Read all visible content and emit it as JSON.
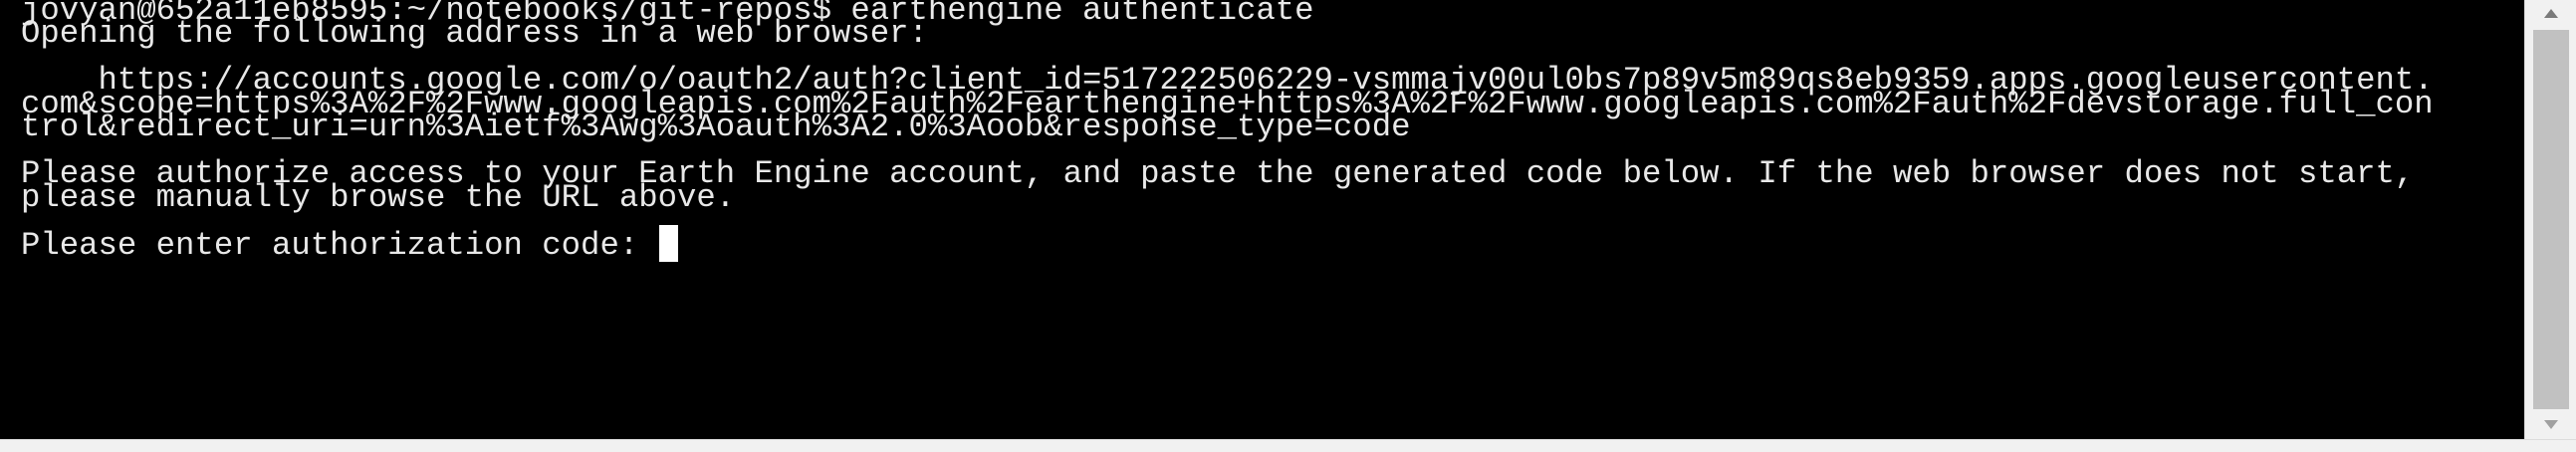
{
  "terminal": {
    "lines": [
      "jovyan@652a11eb8595:~/notebooks/git-repos$ earthengine authenticate",
      "Opening the following address in a web browser:",
      "",
      "    https://accounts.google.com/o/oauth2/auth?client_id=517222506229-vsmmajv00ul0bs7p89v5m89qs8eb9359.apps.googleusercontent.",
      "com&scope=https%3A%2F%2Fwww.googleapis.com%2Fauth%2Fearthengine+https%3A%2F%2Fwww.googleapis.com%2Fauth%2Fdevstorage.full_con",
      "trol&redirect_uri=urn%3Aietf%3Awg%3Aoauth%3A2.0%3Aoob&response_type=code",
      "",
      "Please authorize access to your Earth Engine account, and paste the generated code below. If the web browser does not start,",
      "please manually browse the URL above.",
      "",
      "Please enter authorization code: "
    ]
  },
  "colors": {
    "terminal_background": "#000000",
    "terminal_text": "#e8e8e8",
    "cursor": "#ffffff",
    "scrollbar_track": "#f1f1f1",
    "scrollbar_thumb": "#c1c1c1"
  },
  "icons": {
    "scroll_up": "triangle-up-icon",
    "scroll_down": "triangle-down-icon"
  }
}
